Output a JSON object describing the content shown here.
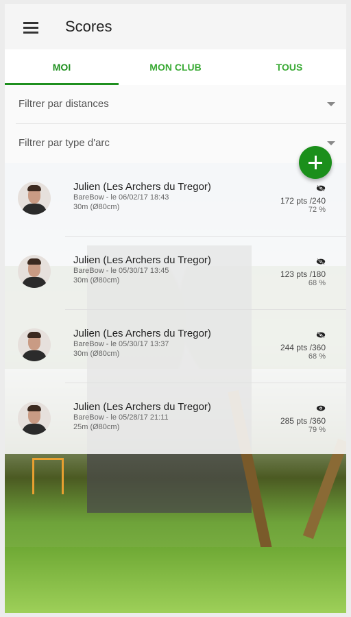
{
  "app_bar": {
    "title": "Scores"
  },
  "tabs": [
    {
      "label": "MOI",
      "selected": true
    },
    {
      "label": "MON CLUB",
      "selected": false
    },
    {
      "label": "TOUS",
      "selected": false
    }
  ],
  "filters": [
    {
      "label": "Filtrer par distances"
    },
    {
      "label": "Filtrer par type d'arc"
    }
  ],
  "fab": {
    "icon": "plus-icon"
  },
  "colors": {
    "accent": "#1b8f1b",
    "tab_text": "#3aaa35"
  },
  "scores": [
    {
      "name": "Julien (Les Archers du Tregor)",
      "details": "BareBow - le 06/02/17 18:43",
      "distance": "30m (Ø80cm)",
      "points": "172 pts /240",
      "percent": "72 %",
      "visibility_icon": "eye-off-icon"
    },
    {
      "name": "Julien (Les Archers du Tregor)",
      "details": "BareBow - le 05/30/17 13:45",
      "distance": "30m (Ø80cm)",
      "points": "123 pts /180",
      "percent": "68 %",
      "visibility_icon": "eye-off-icon"
    },
    {
      "name": "Julien (Les Archers du Tregor)",
      "details": "BareBow - le 05/30/17 13:37",
      "distance": "30m (Ø80cm)",
      "points": "244 pts /360",
      "percent": "68 %",
      "visibility_icon": "eye-off-icon"
    },
    {
      "name": "Julien (Les Archers du Tregor)",
      "details": "BareBow - le 05/28/17 21:11",
      "distance": "25m (Ø80cm)",
      "points": "285 pts /360",
      "percent": "79 %",
      "visibility_icon": "eye-icon"
    }
  ]
}
